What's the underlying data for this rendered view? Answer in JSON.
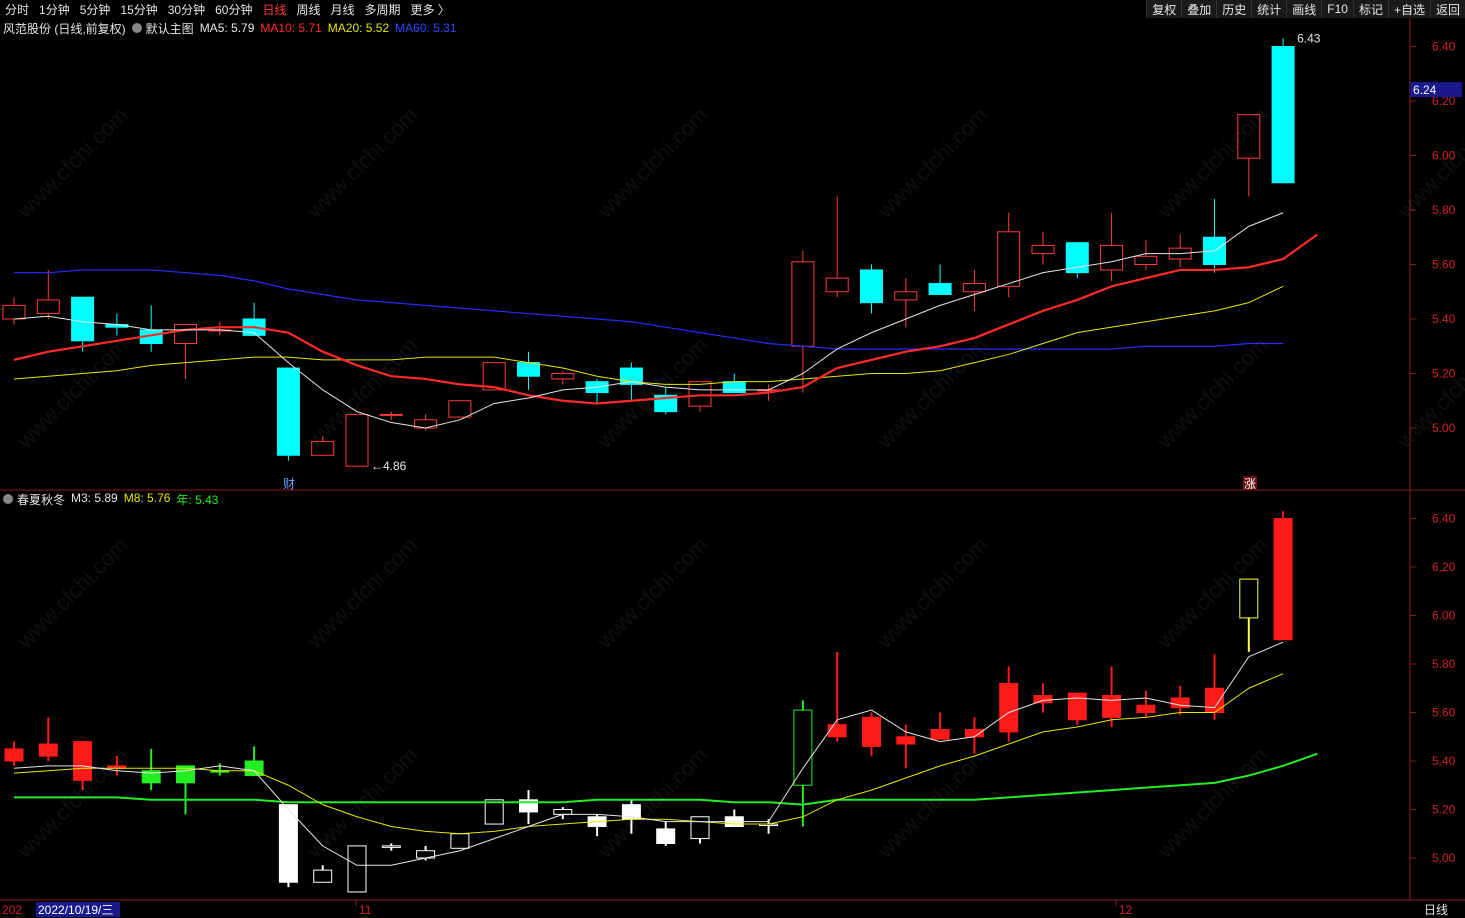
{
  "toolbar": {
    "periods": [
      "分时",
      "1分钟",
      "5分钟",
      "15分钟",
      "30分钟",
      "60分钟",
      "日线",
      "周线",
      "月线",
      "多周期",
      "更多 〉"
    ],
    "active_period": "日线",
    "actions": [
      "复权",
      "叠加",
      "历史",
      "统计",
      "画线",
      "F10",
      "标记",
      "+自选",
      "返回"
    ]
  },
  "main_pane": {
    "stock_title": "风范股份 (日线,前复权)",
    "template": "默认主图",
    "indicators": [
      {
        "label": "MA5: 5.79",
        "color": "#e6e6e6"
      },
      {
        "label": "MA10: 5.71",
        "color": "#ff2a2a"
      },
      {
        "label": "MA20: 5.52",
        "color": "#e6e600"
      },
      {
        "label": "MA60: 5.31",
        "color": "#2b4cff"
      }
    ],
    "price_ticks": [
      "6.40",
      "6.20",
      "6.00",
      "5.80",
      "5.60",
      "5.40",
      "5.20",
      "5.00"
    ],
    "current_price": "6.24",
    "high_label": "6.43",
    "low_label": "4.86",
    "marker_finance": "财",
    "marker_limit": "涨"
  },
  "sub_pane": {
    "title": "春夏秋冬",
    "indicators": [
      {
        "label": "M3: 5.89",
        "color": "#e6e6e6"
      },
      {
        "label": "M8: 5.76",
        "color": "#e6e600"
      },
      {
        "label": "年: 5.43",
        "color": "#22ee22"
      }
    ],
    "price_ticks": [
      "6.40",
      "6.20",
      "6.00",
      "5.80",
      "5.60",
      "5.40",
      "5.20",
      "5.00"
    ]
  },
  "date_axis": {
    "cursor_date": "2022/10/19/三",
    "year_stub": "202",
    "month_labels": [
      "11",
      "12"
    ],
    "period_label": "日线"
  },
  "watermark_text": "www.cfchi.com",
  "chart_data": {
    "type": "candlestick",
    "candles": [
      {
        "o": 5.4,
        "h": 5.48,
        "l": 5.38,
        "c": 5.45
      },
      {
        "o": 5.42,
        "h": 5.58,
        "l": 5.4,
        "c": 5.47
      },
      {
        "o": 5.48,
        "h": 5.48,
        "l": 5.28,
        "c": 5.32
      },
      {
        "o": 5.38,
        "h": 5.42,
        "l": 5.34,
        "c": 5.37
      },
      {
        "o": 5.36,
        "h": 5.45,
        "l": 5.28,
        "c": 5.31
      },
      {
        "o": 5.31,
        "h": 5.38,
        "l": 5.18,
        "c": 5.38
      },
      {
        "o": 5.36,
        "h": 5.39,
        "l": 5.34,
        "c": 5.36
      },
      {
        "o": 5.4,
        "h": 5.46,
        "l": 5.34,
        "c": 5.34
      },
      {
        "o": 5.22,
        "h": 5.22,
        "l": 4.88,
        "c": 4.9
      },
      {
        "o": 4.9,
        "h": 4.97,
        "l": 4.9,
        "c": 4.95
      },
      {
        "o": 4.86,
        "h": 5.05,
        "l": 4.86,
        "c": 5.05
      },
      {
        "o": 5.05,
        "h": 5.06,
        "l": 5.03,
        "c": 5.05
      },
      {
        "o": 5.0,
        "h": 5.05,
        "l": 4.99,
        "c": 5.03
      },
      {
        "o": 5.04,
        "h": 5.1,
        "l": 5.04,
        "c": 5.1
      },
      {
        "o": 5.14,
        "h": 5.24,
        "l": 5.14,
        "c": 5.24
      },
      {
        "o": 5.24,
        "h": 5.28,
        "l": 5.14,
        "c": 5.19
      },
      {
        "o": 5.18,
        "h": 5.21,
        "l": 5.16,
        "c": 5.2
      },
      {
        "o": 5.17,
        "h": 5.18,
        "l": 5.09,
        "c": 5.13
      },
      {
        "o": 5.22,
        "h": 5.24,
        "l": 5.1,
        "c": 5.16
      },
      {
        "o": 5.12,
        "h": 5.15,
        "l": 5.05,
        "c": 5.06
      },
      {
        "o": 5.08,
        "h": 5.17,
        "l": 5.06,
        "c": 5.17
      },
      {
        "o": 5.17,
        "h": 5.2,
        "l": 5.13,
        "c": 5.13
      },
      {
        "o": 5.14,
        "h": 5.16,
        "l": 5.1,
        "c": 5.14
      },
      {
        "o": 5.3,
        "h": 5.65,
        "l": 5.13,
        "c": 5.61
      },
      {
        "o": 5.5,
        "h": 5.85,
        "l": 5.48,
        "c": 5.55
      },
      {
        "o": 5.58,
        "h": 5.6,
        "l": 5.42,
        "c": 5.46
      },
      {
        "o": 5.47,
        "h": 5.55,
        "l": 5.37,
        "c": 5.5
      },
      {
        "o": 5.53,
        "h": 5.6,
        "l": 5.49,
        "c": 5.49
      },
      {
        "o": 5.5,
        "h": 5.58,
        "l": 5.43,
        "c": 5.53
      },
      {
        "o": 5.52,
        "h": 5.79,
        "l": 5.48,
        "c": 5.72
      },
      {
        "o": 5.64,
        "h": 5.72,
        "l": 5.6,
        "c": 5.67
      },
      {
        "o": 5.68,
        "h": 5.68,
        "l": 5.55,
        "c": 5.57
      },
      {
        "o": 5.58,
        "h": 5.79,
        "l": 5.54,
        "c": 5.67
      },
      {
        "o": 5.6,
        "h": 5.69,
        "l": 5.58,
        "c": 5.63
      },
      {
        "o": 5.62,
        "h": 5.71,
        "l": 5.59,
        "c": 5.66
      },
      {
        "o": 5.7,
        "h": 5.84,
        "l": 5.57,
        "c": 5.6
      },
      {
        "o": 5.99,
        "h": 6.15,
        "l": 5.85,
        "c": 6.15
      },
      {
        "o": 6.4,
        "h": 6.43,
        "l": 5.9,
        "c": 5.9
      }
    ],
    "ma5": [
      5.4,
      5.41,
      5.39,
      5.38,
      5.36,
      5.36,
      5.36,
      5.35,
      5.24,
      5.14,
      5.06,
      5.02,
      5.0,
      5.03,
      5.09,
      5.11,
      5.14,
      5.15,
      5.17,
      5.15,
      5.14,
      5.14,
      5.14,
      5.2,
      5.29,
      5.35,
      5.4,
      5.45,
      5.49,
      5.53,
      5.57,
      5.59,
      5.61,
      5.64,
      5.64,
      5.65,
      5.74,
      5.79
    ],
    "ma10": [
      5.25,
      5.28,
      5.3,
      5.32,
      5.34,
      5.36,
      5.37,
      5.37,
      5.35,
      5.28,
      5.23,
      5.19,
      5.18,
      5.16,
      5.15,
      5.12,
      5.1,
      5.09,
      5.1,
      5.11,
      5.12,
      5.12,
      5.13,
      5.15,
      5.22,
      5.25,
      5.28,
      5.3,
      5.33,
      5.38,
      5.43,
      5.47,
      5.52,
      5.55,
      5.58,
      5.58,
      5.59,
      5.62,
      5.71
    ],
    "ma20": [
      5.18,
      5.19,
      5.2,
      5.21,
      5.23,
      5.24,
      5.25,
      5.26,
      5.26,
      5.25,
      5.25,
      5.25,
      5.26,
      5.26,
      5.26,
      5.24,
      5.22,
      5.19,
      5.17,
      5.16,
      5.16,
      5.17,
      5.17,
      5.18,
      5.19,
      5.2,
      5.2,
      5.21,
      5.24,
      5.27,
      5.31,
      5.35,
      5.37,
      5.39,
      5.41,
      5.43,
      5.46,
      5.52
    ],
    "ma60": [
      5.57,
      5.57,
      5.58,
      5.58,
      5.58,
      5.57,
      5.56,
      5.54,
      5.51,
      5.49,
      5.47,
      5.46,
      5.45,
      5.44,
      5.43,
      5.42,
      5.41,
      5.4,
      5.39,
      5.37,
      5.35,
      5.33,
      5.31,
      5.3,
      5.29,
      5.29,
      5.29,
      5.29,
      5.29,
      5.29,
      5.29,
      5.29,
      5.29,
      5.3,
      5.3,
      5.3,
      5.31,
      5.31
    ],
    "sub_ma3": [
      5.37,
      5.38,
      5.38,
      5.36,
      5.35,
      5.36,
      5.38,
      5.36,
      5.2,
      5.05,
      4.97,
      4.97,
      5.0,
      5.03,
      5.08,
      5.13,
      5.18,
      5.18,
      5.17,
      5.15,
      5.15,
      5.15,
      5.15,
      5.37,
      5.57,
      5.61,
      5.52,
      5.48,
      5.5,
      5.6,
      5.65,
      5.66,
      5.65,
      5.66,
      5.63,
      5.62,
      5.83,
      5.89
    ],
    "sub_ma8": [
      5.35,
      5.36,
      5.37,
      5.37,
      5.37,
      5.37,
      5.36,
      5.36,
      5.3,
      5.22,
      5.17,
      5.13,
      5.11,
      5.1,
      5.11,
      5.13,
      5.14,
      5.15,
      5.16,
      5.16,
      5.15,
      5.14,
      5.14,
      5.17,
      5.24,
      5.28,
      5.33,
      5.38,
      5.42,
      5.47,
      5.52,
      5.54,
      5.57,
      5.58,
      5.6,
      5.6,
      5.7,
      5.76
    ],
    "sub_year": [
      5.25,
      5.25,
      5.25,
      5.25,
      5.24,
      5.24,
      5.24,
      5.24,
      5.23,
      5.23,
      5.23,
      5.23,
      5.23,
      5.23,
      5.23,
      5.23,
      5.23,
      5.24,
      5.24,
      5.24,
      5.24,
      5.23,
      5.23,
      5.22,
      5.24,
      5.24,
      5.24,
      5.24,
      5.24,
      5.25,
      5.26,
      5.27,
      5.28,
      5.29,
      5.3,
      5.31,
      5.34,
      5.38,
      5.43
    ],
    "sub_candle_colors": [
      "red",
      "red",
      "red",
      "red",
      "green",
      "green",
      "green",
      "green",
      "white",
      "white",
      "white",
      "white",
      "white",
      "white",
      "white",
      "white",
      "white",
      "white",
      "white",
      "white",
      "white",
      "white",
      "white",
      "green",
      "red",
      "red",
      "red",
      "red",
      "red",
      "red",
      "red",
      "red",
      "red",
      "red",
      "red",
      "red",
      "yellow",
      "red"
    ]
  }
}
